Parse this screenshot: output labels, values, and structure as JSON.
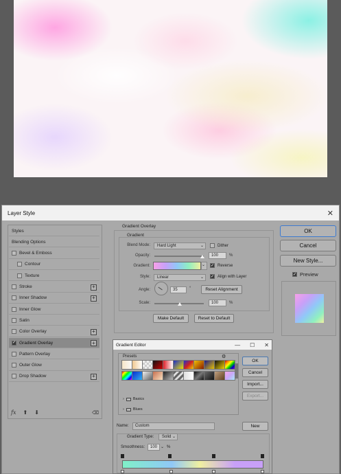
{
  "layer_style": {
    "title": "Layer Style",
    "styles_list": [
      {
        "label": "Styles",
        "type": "header"
      },
      {
        "label": "Blending Options",
        "type": "header"
      },
      {
        "label": "Bevel & Emboss",
        "checked": false
      },
      {
        "label": "Contour",
        "checked": false,
        "indent": true
      },
      {
        "label": "Texture",
        "checked": false,
        "indent": true
      },
      {
        "label": "Stroke",
        "checked": false,
        "plus": true
      },
      {
        "label": "Inner Shadow",
        "checked": false,
        "plus": true
      },
      {
        "label": "Inner Glow",
        "checked": false
      },
      {
        "label": "Satin",
        "checked": false
      },
      {
        "label": "Color Overlay",
        "checked": false,
        "plus": true
      },
      {
        "label": "Gradient Overlay",
        "checked": true,
        "plus": true,
        "selected": true
      },
      {
        "label": "Pattern Overlay",
        "checked": false
      },
      {
        "label": "Outer Glow",
        "checked": false
      },
      {
        "label": "Drop Shadow",
        "checked": false,
        "plus": true
      }
    ],
    "footer": {
      "fx": "fx",
      "up": "⬆",
      "down": "⬇",
      "trash": "🗑"
    },
    "section_title": "Gradient Overlay",
    "group_title": "Gradient",
    "blend_mode": {
      "label": "Blend Mode:",
      "value": "Hard Light"
    },
    "dither": {
      "label": "Dither",
      "checked": false
    },
    "opacity": {
      "label": "Opacity:",
      "value": "100",
      "unit": "%",
      "level": 1.0
    },
    "gradient": {
      "label": "Gradient:"
    },
    "reverse": {
      "label": "Reverse",
      "checked": true
    },
    "style": {
      "label": "Style:",
      "value": "Linear"
    },
    "align_with_layer": {
      "label": "Align with Layer",
      "checked": true
    },
    "angle": {
      "label": "Angle:",
      "value": "35",
      "unit": "°"
    },
    "reset_alignment": "Reset Alignment",
    "scale": {
      "label": "Scale:",
      "value": "100",
      "unit": "%",
      "level": 0.5
    },
    "make_default": "Make Default",
    "reset_to_default": "Reset to Default",
    "buttons": {
      "ok": "OK",
      "cancel": "Cancel",
      "new_style": "New Style..."
    },
    "preview": {
      "label": "Preview",
      "checked": true
    }
  },
  "gradient_editor": {
    "title": "Gradient Editor",
    "window_controls": {
      "minimize": "—",
      "maximize": "☐",
      "close": "✕"
    },
    "presets_label": "Presets",
    "folders": [
      "Basics",
      "Blues"
    ],
    "buttons": {
      "ok": "OK",
      "cancel": "Cancel",
      "import": "Import...",
      "export": "Export...",
      "new": "New"
    },
    "name": {
      "label": "Name:",
      "value": "Custom"
    },
    "gradient_type": {
      "label": "Gradient Type:",
      "value": "Solid"
    },
    "smoothness": {
      "label": "Smoothness:",
      "value": "100",
      "unit": "%"
    }
  },
  "colors": {
    "accent": "#3d7ad0",
    "dialog_bg": "#a9a9a9",
    "titlebar": "#f1f1f1"
  }
}
